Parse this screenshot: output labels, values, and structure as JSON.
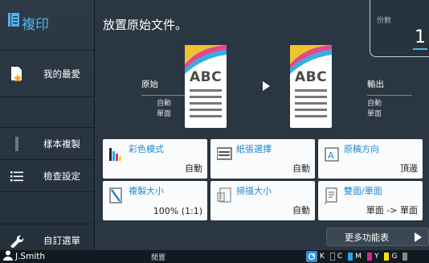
{
  "sidebar": {
    "title": "複印",
    "items": [
      {
        "label": "我的最愛",
        "icon": "star-document-icon"
      },
      {
        "label": "樣本複製",
        "icon": "sample-copy-icon"
      },
      {
        "label": "檢查設定",
        "icon": "list-icon"
      },
      {
        "label": "自訂選單",
        "icon": "wrench-icon"
      }
    ]
  },
  "main": {
    "instruction": "放置原始文件。",
    "copies_label": "份數",
    "copies_value": "1",
    "original": {
      "head": "原始",
      "line1": "自動",
      "line2": "單面"
    },
    "output": {
      "head": "輸出",
      "line1": "自動",
      "line2": "單面"
    },
    "doc_text": "ABC"
  },
  "tiles": [
    {
      "name": "彩色模式",
      "value": "自動",
      "icon": "color-mode-icon"
    },
    {
      "name": "紙張選擇",
      "value": "自動",
      "icon": "paper-tray-icon"
    },
    {
      "name": "原稿方向",
      "value": "頂邊",
      "icon": "orientation-icon"
    },
    {
      "name": "複製大小",
      "value": "100% (1:1)",
      "icon": "reduce-enlarge-icon"
    },
    {
      "name": "掃描大小",
      "value": "自動",
      "icon": "scan-size-icon"
    },
    {
      "name": "雙面/單面",
      "value": "單面 -> 單面",
      "icon": "duplex-icon"
    }
  ],
  "more_button": "更多功能表",
  "status": {
    "user": "J.Smith",
    "state": "閒置",
    "inks": [
      {
        "label": "K",
        "color": "#111111"
      },
      {
        "label": "C",
        "color": "#21a7e8"
      },
      {
        "label": "M",
        "color": "#e2218e"
      },
      {
        "label": "Y",
        "color": "#f4e400"
      },
      {
        "label": "G",
        "color": "#8a8a8a"
      }
    ]
  },
  "colors": {
    "accent": "#4fb3ec",
    "background": "#2a3641",
    "tile": "#fafbfc"
  }
}
